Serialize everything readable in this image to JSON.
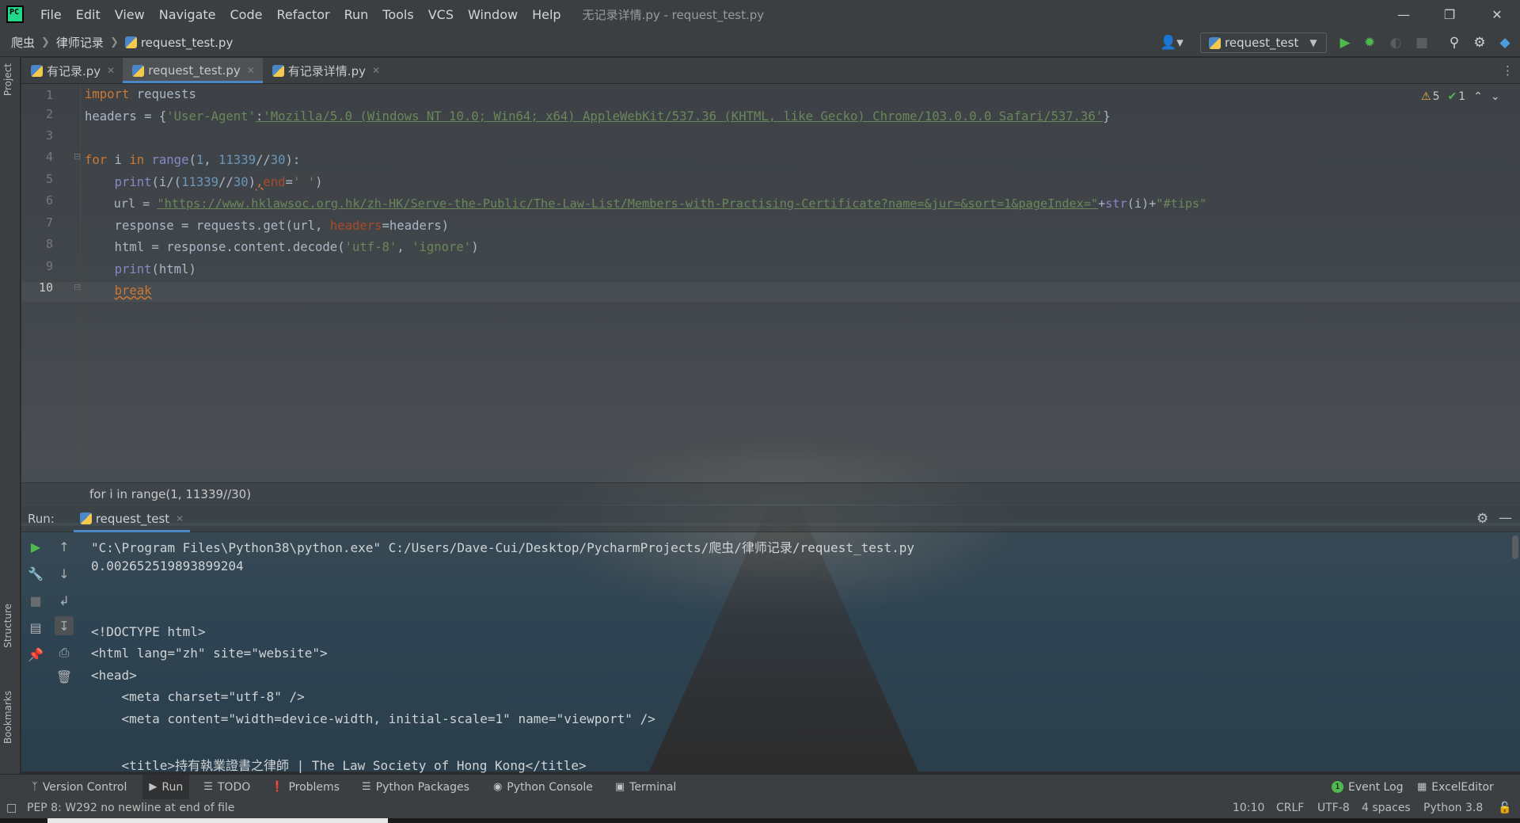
{
  "menubar": {
    "items": [
      "File",
      "Edit",
      "View",
      "Navigate",
      "Code",
      "Refactor",
      "Run",
      "Tools",
      "VCS",
      "Window",
      "Help"
    ],
    "window_title": "无记录详情.py - request_test.py"
  },
  "navbar": {
    "crumbs": [
      "爬虫",
      "律师记录",
      "request_test.py"
    ],
    "run_config": "request_test"
  },
  "editor_tabs": [
    {
      "label": "有记录.py",
      "active": false
    },
    {
      "label": "request_test.py",
      "active": true
    },
    {
      "label": "有记录详情.py",
      "active": false
    }
  ],
  "left_strip": {
    "project": "Project",
    "structure": "Structure",
    "bookmarks": "Bookmarks"
  },
  "editor": {
    "line_numbers": [
      "1",
      "2",
      "3",
      "4",
      "5",
      "6",
      "7",
      "8",
      "9",
      "10"
    ],
    "tokens": {
      "l1_kw": "import",
      "l1_rest": " requests",
      "l2_a": "headers = {",
      "l2_key": "'User-Agent'",
      "l2_colon": ":",
      "l2_val": "'Mozilla/5.0 (Windows NT 10.0; Win64; x64) AppleWebKit/537.36 (KHTML, like Gecko) Chrome/103.0.0.0 Safari/537.36'",
      "l2_end": "}",
      "l4_for": "for",
      "l4_i": " i ",
      "l4_in": "in",
      "l4_range": " range",
      "l4_p1": "(",
      "l4_n1": "1",
      "l4_c": ", ",
      "l4_n2": "11339",
      "l4_op": "//",
      "l4_n3": "30",
      "l4_end": "):",
      "l5_indent": "    ",
      "l5_print": "print",
      "l5_a": "(i/(",
      "l5_n1": "11339",
      "l5_op": "//",
      "l5_n2": "30",
      "l5_b": ")",
      "l5_comma": ",",
      "l5_end": "end",
      "l5_eq": "=",
      "l5_str": "' '",
      "l5_close": ")",
      "l6_a": "    url = ",
      "l6_str": "\"https://www.hklawsoc.org.hk/zh-HK/Serve-the-Public/The-Law-List/Members-with-Practising-Certificate?name=&jur=&sort=1&pageIndex=\"",
      "l6_plus": "+",
      "l6_str2": "str",
      "l6_b": "(i)+",
      "l6_tips": "\"#tips\"",
      "l7_a": "    response = requests.get(url, ",
      "l7_param": "headers",
      "l7_b": "=headers)",
      "l8_a": "    html = response.content.decode(",
      "l8_s1": "'utf-8'",
      "l8_c": ", ",
      "l8_s2": "'ignore'",
      "l8_b": ")",
      "l9_a": "    ",
      "l9_print": "print",
      "l9_b": "(html)",
      "l10_a": "    ",
      "l10_kw": "break"
    },
    "warnings": "5",
    "oks": "1"
  },
  "code_crumb": "for i in range(1, 11339//30)",
  "run": {
    "label": "Run:",
    "tab": "request_test",
    "output": [
      "\"C:\\Program Files\\Python38\\python.exe\" C:/Users/Dave-Cui/Desktop/PycharmProjects/爬虫/律师记录/request_test.py",
      "0.002652519893899204",
      "",
      "",
      "<!DOCTYPE html>",
      "<html lang=\"zh\" site=\"website\">",
      "<head>",
      "    <meta charset=\"utf-8\" />",
      "    <meta content=\"width=device-width, initial-scale=1\" name=\"viewport\" />",
      "",
      "    <title>持有執業證書之律師 | The Law Society of Hong Kong</title>"
    ]
  },
  "toolbar_windows": [
    "Version Control",
    "Run",
    "TODO",
    "Problems",
    "Python Packages",
    "Python Console",
    "Terminal"
  ],
  "toolbar_right": [
    "Event Log",
    "ExcelEditor"
  ],
  "event_count": "1",
  "status": {
    "message": "PEP 8: W292 no newline at end of file",
    "position": "10:10",
    "line_sep": "CRLF",
    "encoding": "UTF-8",
    "indent": "4 spaces",
    "interpreter": "Python 3.8"
  }
}
